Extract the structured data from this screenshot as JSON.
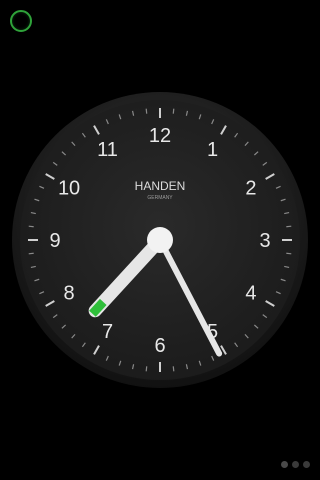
{
  "brand": {
    "name": "HANDEN",
    "origin": "GERMANY"
  },
  "dial": {
    "numerals": [
      "12",
      "1",
      "2",
      "3",
      "4",
      "5",
      "6",
      "7",
      "8",
      "9",
      "10",
      "11"
    ]
  },
  "time": {
    "hour": 7,
    "minute": 25,
    "second": 25
  },
  "colors": {
    "background": "#000000",
    "dial": "#232323",
    "accent": "#2fbf3a",
    "hands": "#e6e6e6"
  },
  "pager": {
    "page_count": 3,
    "current": 0
  },
  "icons": {
    "status": "status-ring-icon"
  }
}
